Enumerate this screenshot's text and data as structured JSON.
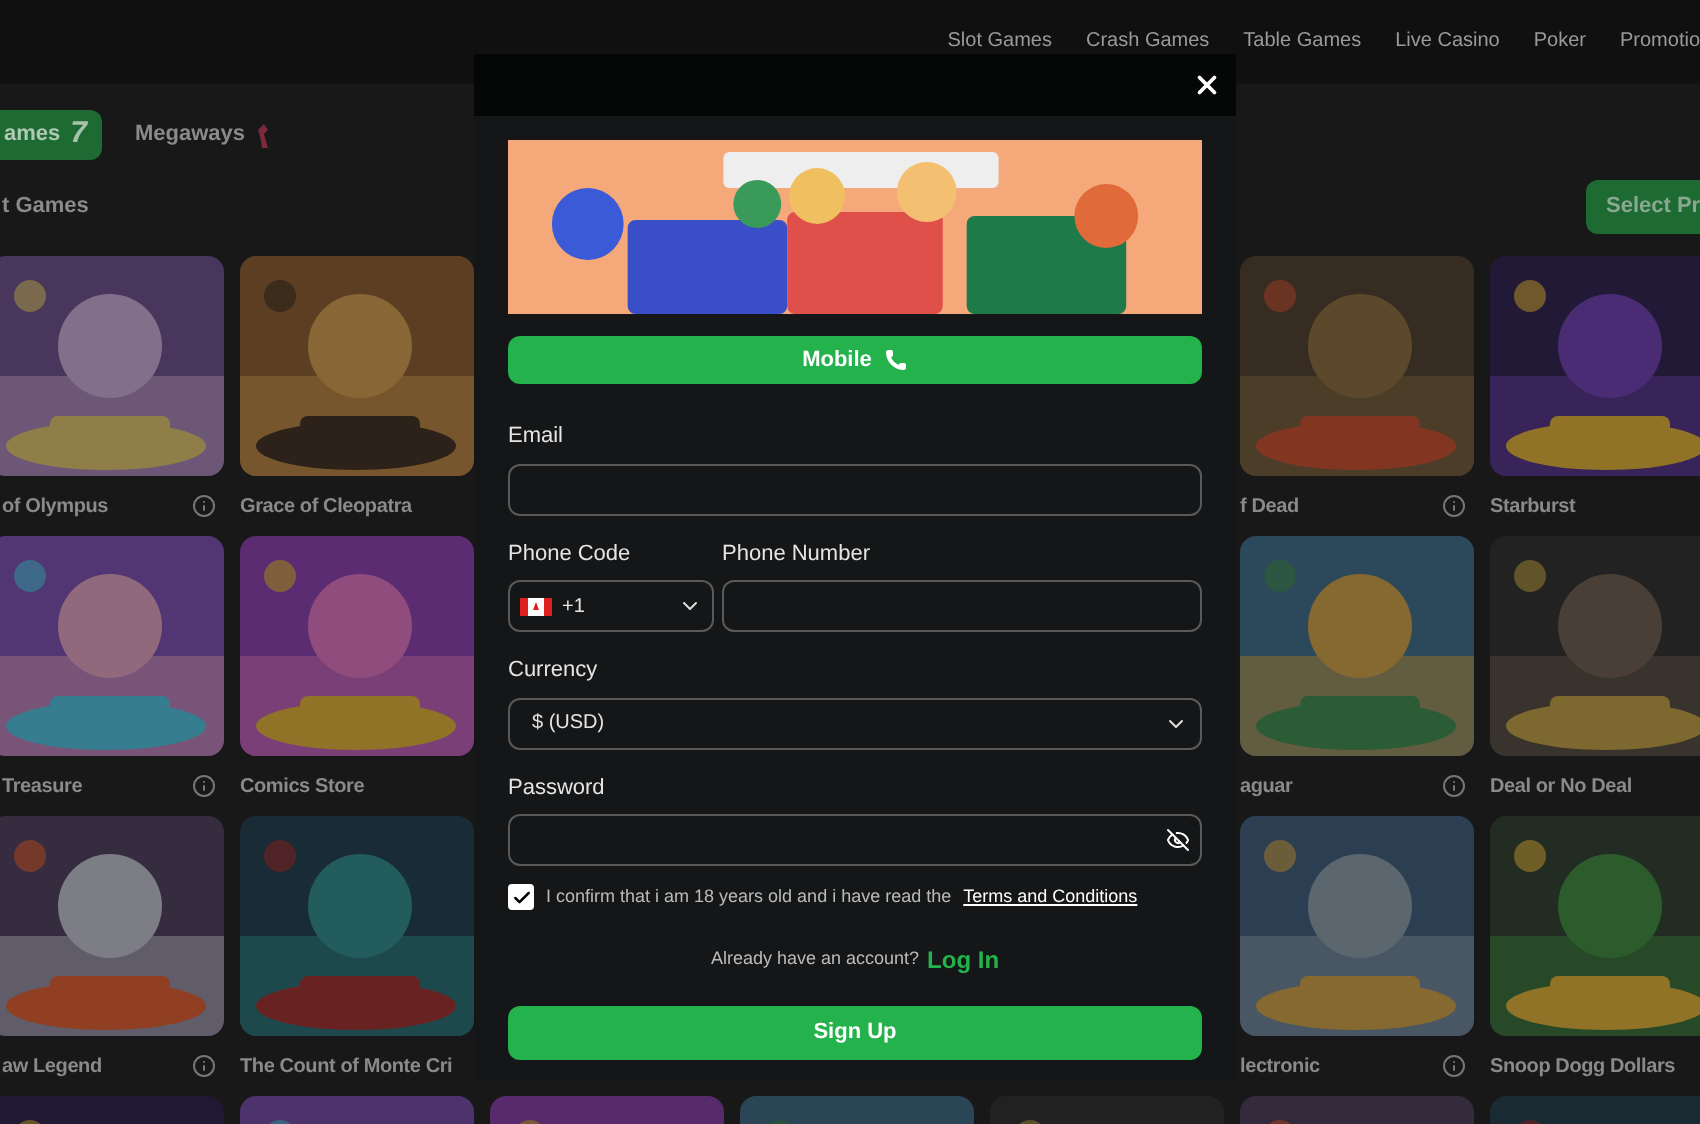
{
  "nav": {
    "items": [
      "Slot Games",
      "Crash Games",
      "Table Games",
      "Live Casino",
      "Poker",
      "Promotio"
    ]
  },
  "category_tabs": [
    {
      "label": "ames",
      "badge": "7",
      "selected": true
    },
    {
      "label": "Megaways",
      "selected": false
    }
  ],
  "section": {
    "title": "t Games",
    "button": "Select Pr"
  },
  "game_rows": [
    {
      "left": [
        "of Olympus",
        "Grace of Cleopatra"
      ],
      "right": [
        "f Dead",
        "Starburst"
      ]
    },
    {
      "left": [
        "Treasure",
        "Comics Store"
      ],
      "right": [
        "aguar",
        "Deal or No Deal"
      ]
    },
    {
      "left": [
        "aw Legend",
        "The Count of Monte Cri"
      ],
      "right": [
        "lectronic",
        "Snoop Dogg Dollars"
      ]
    }
  ],
  "modal": {
    "mobile_button": "Mobile",
    "email": {
      "label": "Email"
    },
    "phone_code": {
      "label": "Phone Code",
      "value": "+1"
    },
    "phone_number": {
      "label": "Phone Number"
    },
    "currency": {
      "label": "Currency",
      "value": "$ (USD)"
    },
    "password": {
      "label": "Password"
    },
    "consent": {
      "checked": true,
      "text": "I confirm that i am 18 years old and i have read the",
      "link": "Terms and Conditions"
    },
    "login_prompt": {
      "text": "Already have an account?",
      "link": "Log In"
    },
    "submit": "Sign Up"
  }
}
